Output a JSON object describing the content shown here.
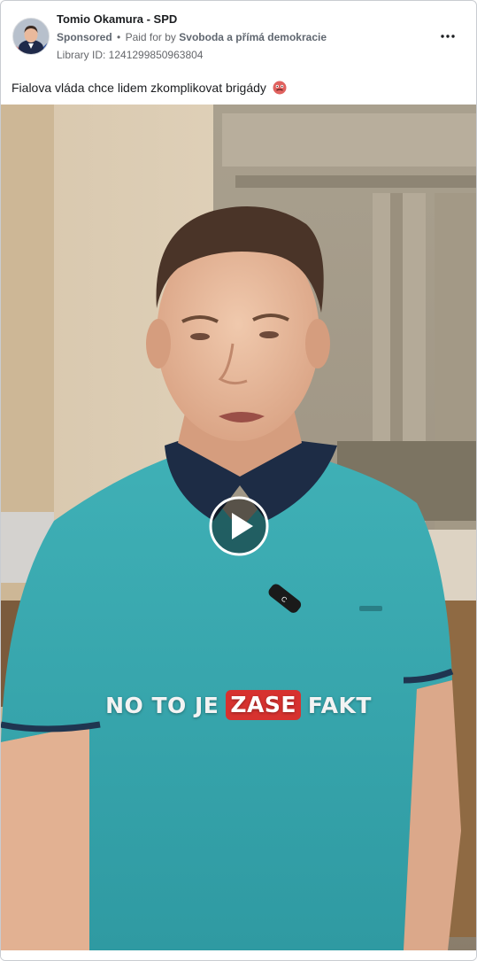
{
  "post": {
    "page_name": "Tomio Okamura - SPD",
    "sponsored_label": "Sponsored",
    "separator": "•",
    "paid_for_label": "Paid for by",
    "funder": "Svoboda a přímá demokracie",
    "library_id": "Library ID: 1241299850963804",
    "caption": "Fialova vláda chce lidem zkomplikovat brigády",
    "caption_emoji": "nauseated-face-emoji",
    "more_icon": "more-options-icon"
  },
  "video": {
    "overlay_words": [
      "NO TO JE",
      "ZASE",
      "FAKT"
    ],
    "highlight_color": "#d7322f",
    "play_icon": "play-icon",
    "shirt_color": "#3aa5ac",
    "mic_label": "C"
  },
  "colors": {
    "border": "#c9ccd1",
    "secondary_text": "#65676b",
    "primary_text": "#1c1e21"
  }
}
